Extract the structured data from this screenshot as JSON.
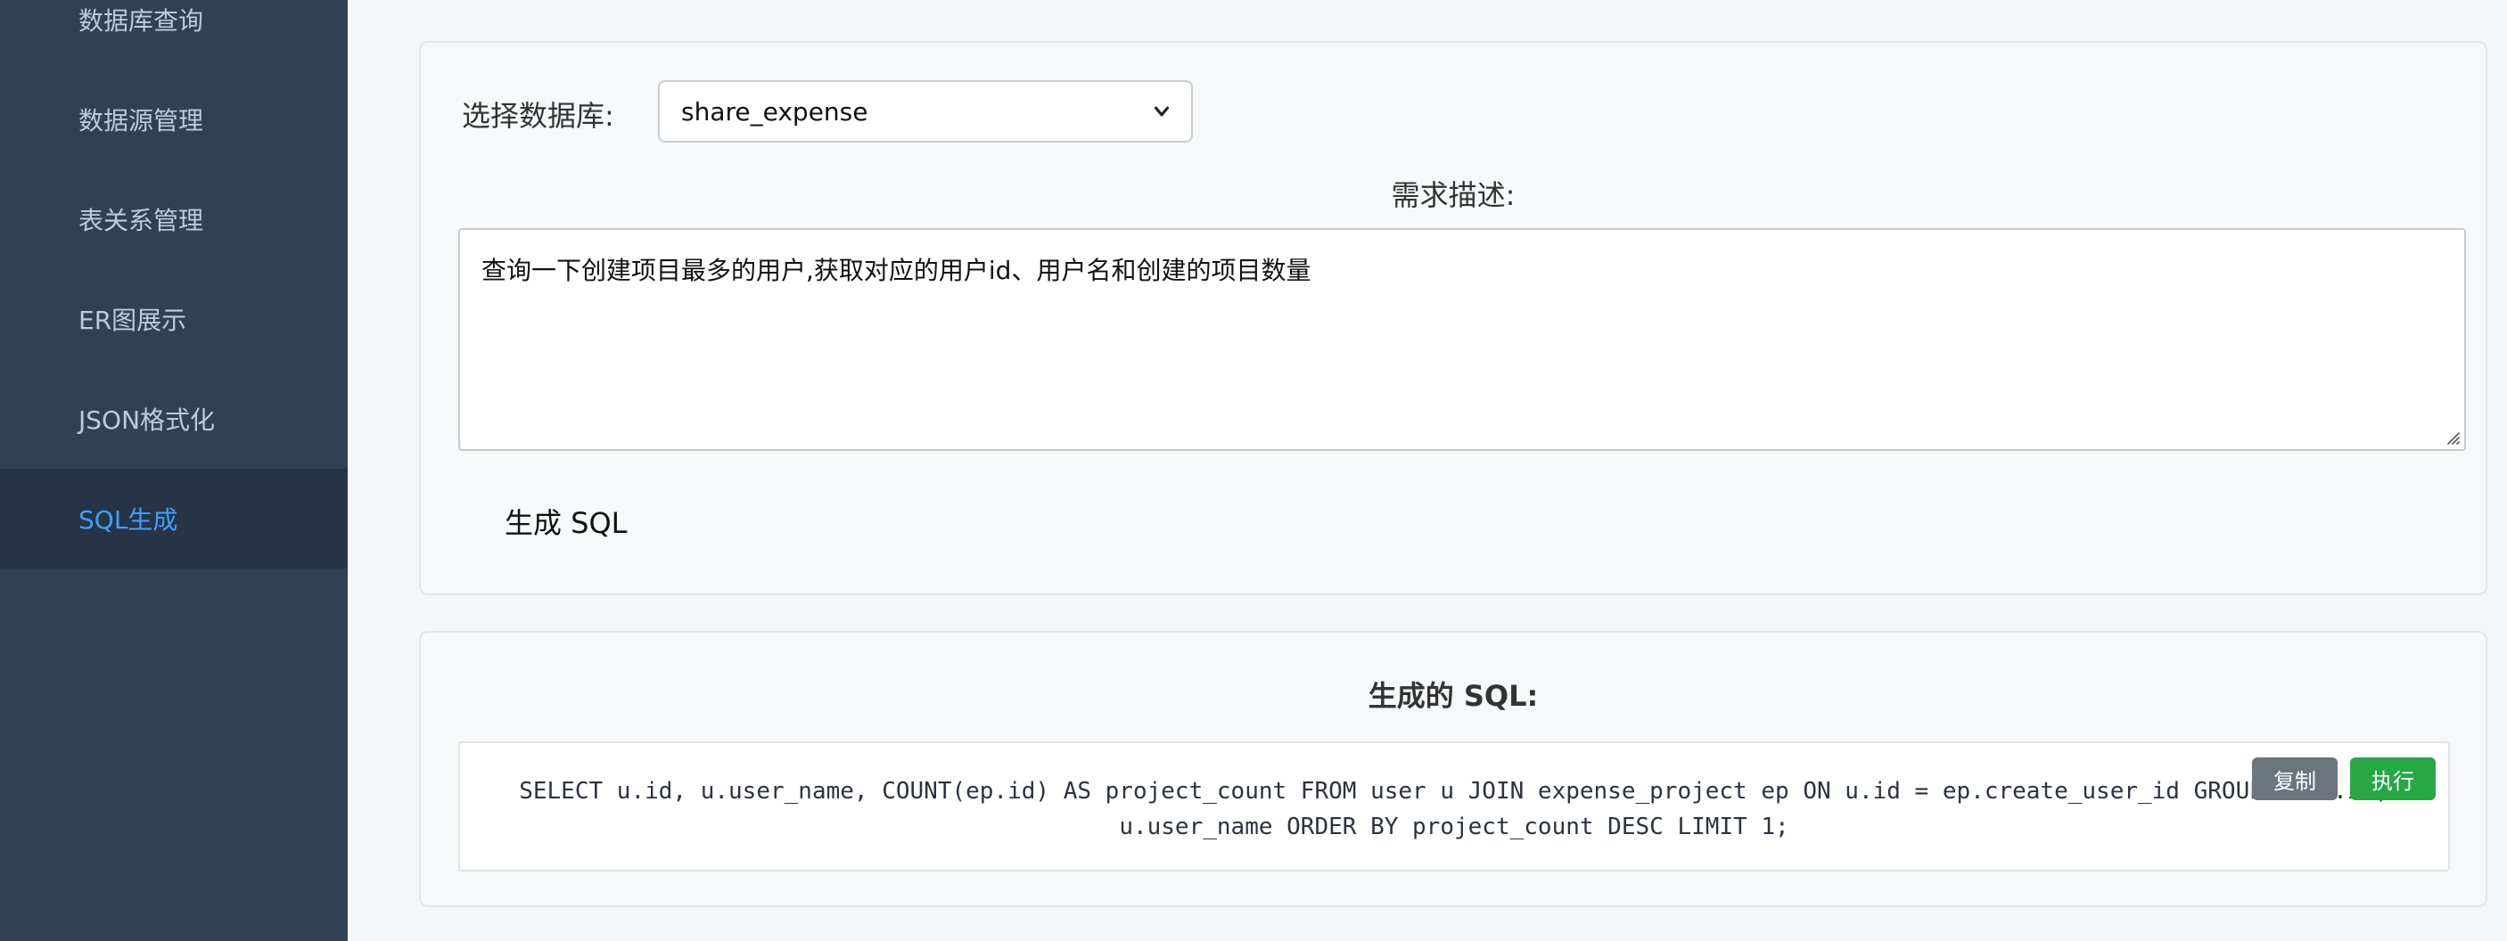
{
  "sidebar": {
    "items": [
      {
        "label": "数据库查询"
      },
      {
        "label": "数据源管理"
      },
      {
        "label": "表关系管理"
      },
      {
        "label": "ER图展示"
      },
      {
        "label": "JSON格式化"
      },
      {
        "label": "SQL生成"
      }
    ],
    "active_color": "#409eff"
  },
  "form": {
    "db_label": "选择数据库:",
    "db_selected": "share_expense",
    "requirement_title": "需求描述:",
    "requirement_text": "查询一下创建项目最多的用户,获取对应的用户id、用户名和创建的项目数量",
    "generate_button": "生成 SQL"
  },
  "result": {
    "title": "生成的 SQL:",
    "sql": "SELECT u.id, u.user_name, COUNT(ep.id) AS project_count FROM user u JOIN expense_project ep ON u.id = ep.create_user_id GROUP BY u.id, u.user_name ORDER BY project_count DESC LIMIT 1;",
    "copy_button": "复制",
    "execute_button": "执行",
    "copy_color": "#6c757d",
    "execute_color": "#28a745"
  }
}
